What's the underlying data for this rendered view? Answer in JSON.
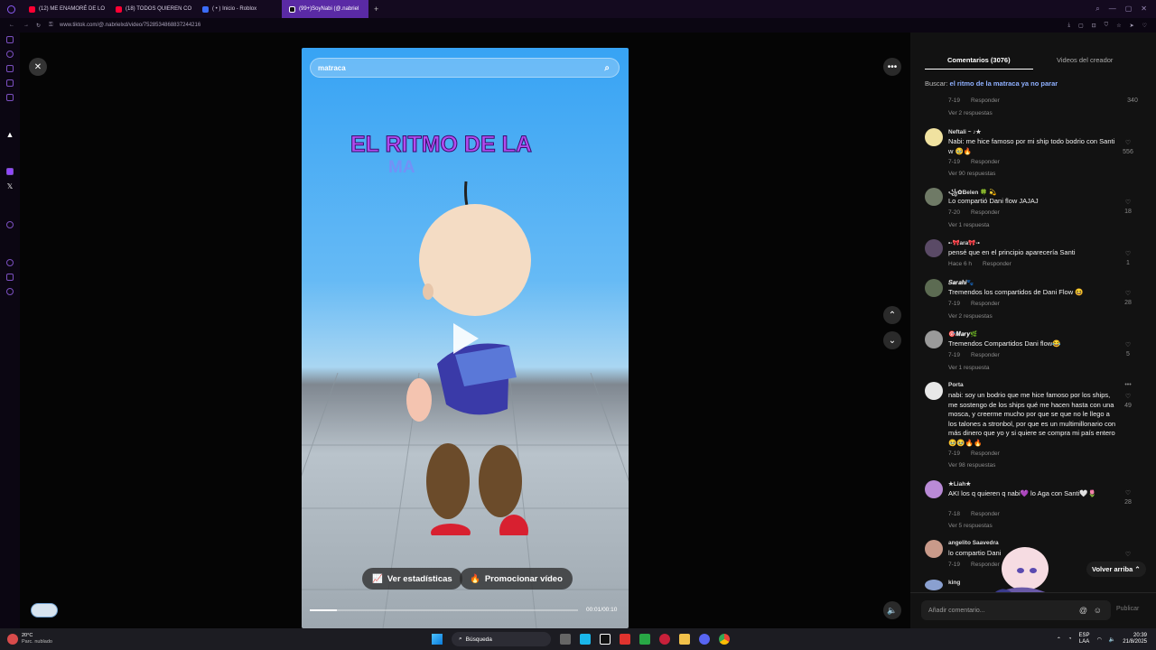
{
  "browser": {
    "tabs": [
      {
        "label": "(12) ME ENAMORÉ DE LO",
        "color": "#ff0033"
      },
      {
        "label": "(18) TODOS QUIEREN CO",
        "color": "#ff0033"
      },
      {
        "label": "( • ) Inicio - Roblox",
        "color": "#3b6cf6"
      },
      {
        "label": "(99+)SoyNabi (@.nabriel",
        "color": "#ffffff"
      }
    ],
    "new_tab": "+",
    "url": "www.tiktok.com/@.nabrielxd/video/7528534868837244216"
  },
  "video": {
    "search_value": "matraca",
    "title_line1": "EL RITMO DE LA",
    "title_line2": "MA",
    "stats_button": "Ver estadísticas",
    "promote_button": "Promocionar vídeo",
    "time": "00:01/00:10",
    "progress": 0.1
  },
  "comments": {
    "tab_comments": "Comentarios (3076)",
    "tab_videos": "Videos del creador",
    "search_prefix": "Buscar:",
    "search_link": "el ritmo de la matraca ya no parar",
    "top_meta": {
      "date": "7-19",
      "reply": "Responder",
      "likes": "340",
      "replies": "Ver 2 respuestas"
    },
    "items": [
      {
        "name": "Neftali ~ ♪★",
        "text": "Nabi: me hice famoso por mi ship todo bodrio con Santi w 🥹🔥",
        "date": "7-19",
        "reply": "Responder",
        "likes": "556",
        "replies": "Ver 90 respuestas",
        "color": "#f0e2a0"
      },
      {
        "name": "꧁✿Belen 🍀 💫",
        "text": "Lo compartió Dani flow JAJAJ",
        "date": "7-20",
        "reply": "Responder",
        "likes": "18",
        "replies": "Ver 1 respuesta",
        "color": "#6f7a66"
      },
      {
        "name": "•-🎀ara🎀-•",
        "text": "pensé que en el principio aparecería Santi",
        "date": "Hace 6 h",
        "reply": "Responder",
        "likes": "1",
        "replies": "",
        "color": "#5a4a66"
      },
      {
        "name": "𝑺𝒂𝒓𝒂𝒉𝒊🐾",
        "text": "Tremendos los compartidos de Dani Flow 😆",
        "date": "7-19",
        "reply": "Responder",
        "likes": "28",
        "replies": "Ver 2 respuestas",
        "color": "#5c6b52"
      },
      {
        "name": "🎯𝑴𝒂𝒓𝒚🌿",
        "text": "Tremendos Compartidos Dani flow😂",
        "date": "7-19",
        "reply": "Responder",
        "likes": "5",
        "replies": "Ver 1 respuesta",
        "color": "#9a9a9a"
      },
      {
        "name": "Porta",
        "text": "nabi: soy un bodrio que me hice famoso por los ships, me sostengo de los ships qué me hacen hasta con una mosca, y creerme mucho por que se que no le llego a los talones a stronbol, por que es un multimillonario con más dinero que yo y si quiere se compra mi país entero🥹🥹🔥🔥",
        "date": "7-19",
        "reply": "Responder",
        "likes": "49",
        "replies": "Ver 98 respuestas",
        "color": "#e8e8e8"
      },
      {
        "name": "★Liah★",
        "text": "AKI los q quieren q nabi💜 lo Aga con Santi🤍🌷",
        "date": "7-18",
        "reply": "Responder",
        "likes": "28",
        "replies": "Ver 5 respuestas",
        "color": "#b98ad6"
      },
      {
        "name": "angelito Saavedra",
        "text": "lo compartio Dani",
        "date": "7-19",
        "reply": "Responder",
        "likes": "",
        "replies": "",
        "color": "#c99a8a"
      },
      {
        "name": "king",
        "text": "",
        "date": "",
        "reply": "",
        "likes": "",
        "replies": "",
        "color": "#8aa0d0"
      }
    ],
    "back_to_top": "Volver arriba ⌃",
    "add_comment_placeholder": "Añadir comentario...",
    "publish": "Publicar"
  },
  "taskbar": {
    "weather_temp": "20°C",
    "weather_desc": "Parc. nublado",
    "search": "Búsqueda",
    "lang": "ESP",
    "lang2": "LAA",
    "time": "20:39",
    "date": "21/8/2025"
  },
  "icons": [
    "close-icon",
    "more-icon",
    "chevron-up-icon",
    "chevron-down-icon",
    "volume-icon",
    "search-icon",
    "play-icon",
    "heart-icon",
    "at-icon",
    "emoji-icon"
  ]
}
